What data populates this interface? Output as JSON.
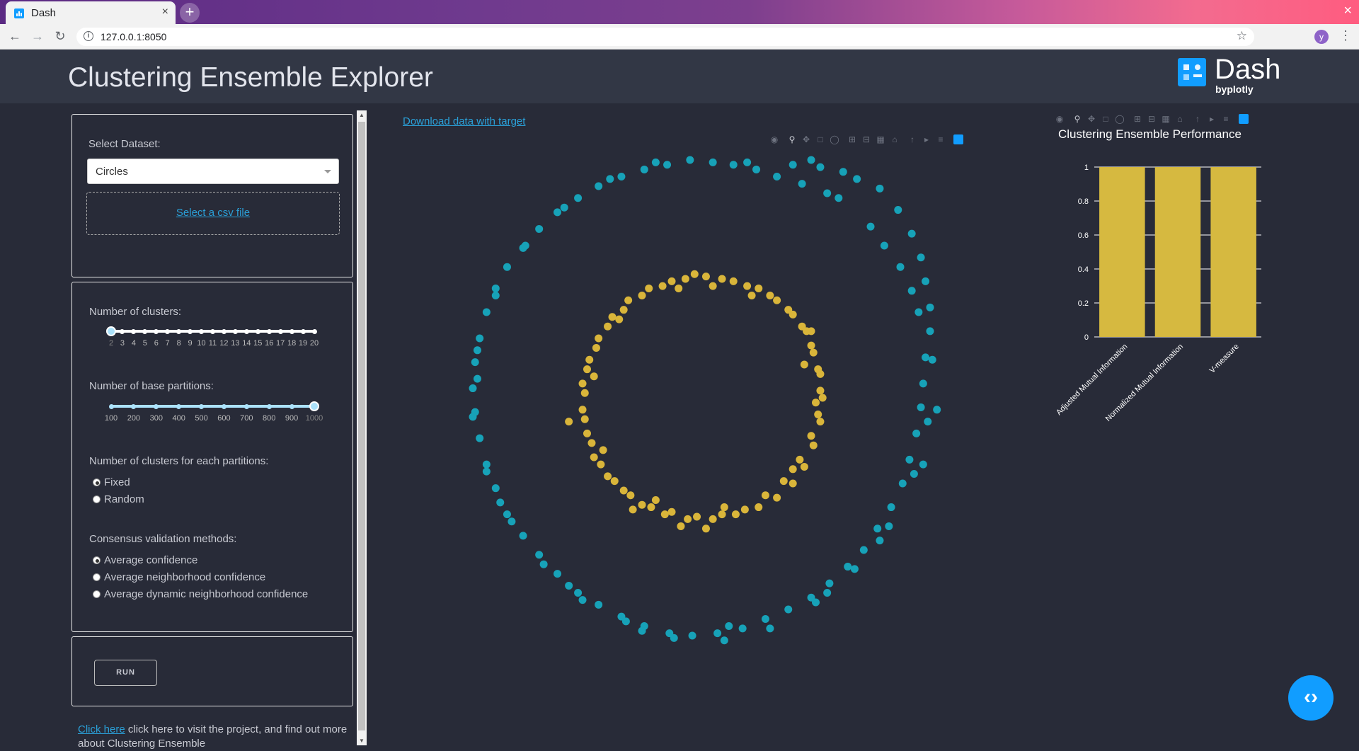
{
  "browser": {
    "tab_title": "Dash",
    "tab_close": "×",
    "new_tab": "+",
    "window_close": "×",
    "url": "127.0.0.1:8050",
    "profile_initial": "y",
    "icons": [
      "back-arrow-icon",
      "forward-arrow-icon",
      "reload-icon",
      "info-icon",
      "star-icon",
      "menu-dots-icon"
    ]
  },
  "header": {
    "title": "Clustering Ensemble Explorer",
    "logo_word": "Dash",
    "logo_by": "byplotly"
  },
  "dataset": {
    "label": "Select Dataset:",
    "selected": "Circles",
    "upload_link": "Select a csv file"
  },
  "clusters_slider": {
    "label": "Number of clusters:",
    "marks": [
      "2",
      "3",
      "4",
      "5",
      "6",
      "7",
      "8",
      "9",
      "10",
      "11",
      "12",
      "13",
      "14",
      "15",
      "16",
      "17",
      "18",
      "19",
      "20"
    ],
    "value": "2"
  },
  "partitions_slider": {
    "label": "Number of base partitions:",
    "marks": [
      "100",
      "200",
      "300",
      "400",
      "500",
      "600",
      "700",
      "800",
      "900",
      "1000"
    ],
    "value": "1000"
  },
  "cluster_mode": {
    "label": "Number of clusters for each partitions:",
    "options": [
      "Fixed",
      "Random"
    ],
    "selected": "Fixed"
  },
  "validation": {
    "label": "Consensus validation methods:",
    "options": [
      "Average confidence",
      "Average neighborhood confidence",
      "Average dynamic neighborhood confidence"
    ],
    "selected": "Average confidence"
  },
  "run_button": "RUN",
  "footer": {
    "link": "Click here",
    "text": " click here to visit the project, and find out more about Clustering Ensemble"
  },
  "download_link": "Download data with target",
  "modebar_icons": [
    "camera-icon",
    "zoom-icon",
    "pan-icon",
    "box-select-icon",
    "lasso-icon",
    "zoom-in-icon",
    "zoom-out-icon",
    "autoscale-icon",
    "reset-axes-icon",
    "spike-lines-icon",
    "hover-closest-icon",
    "hover-compare-icon",
    "plotly-logo-icon"
  ],
  "colors": {
    "background": "#282b38",
    "header": "#323745",
    "cluster_outer": "#17a2b8",
    "cluster_inner": "#d9b53a",
    "accent": "#119dff",
    "bar": "#d6b940"
  },
  "chart_data": [
    {
      "type": "scatter",
      "title": "",
      "xlabel": "",
      "ylabel": "",
      "grid": false,
      "series": [
        {
          "color": "#17a2b8",
          "points": [
            [
              0.4,
              0.98
            ],
            [
              0.48,
              1.0
            ],
            [
              0.52,
              0.97
            ],
            [
              0.62,
              0.95
            ],
            [
              0.68,
              0.92
            ],
            [
              0.78,
              0.88
            ],
            [
              0.86,
              0.79
            ],
            [
              0.92,
              0.69
            ],
            [
              0.96,
              0.59
            ],
            [
              0.98,
              0.49
            ],
            [
              1.0,
              0.38
            ],
            [
              1.0,
              0.28
            ],
            [
              0.98,
              0.17
            ],
            [
              0.97,
              0.06
            ],
            [
              0.96,
              -0.04
            ],
            [
              0.94,
              -0.15
            ],
            [
              0.91,
              -0.26
            ],
            [
              0.88,
              -0.36
            ],
            [
              0.83,
              -0.46
            ],
            [
              0.77,
              -0.55
            ],
            [
              0.71,
              -0.64
            ],
            [
              0.64,
              -0.71
            ],
            [
              0.56,
              -0.78
            ],
            [
              0.48,
              -0.84
            ],
            [
              0.38,
              -0.89
            ],
            [
              0.28,
              -0.93
            ],
            [
              0.18,
              -0.97
            ],
            [
              0.07,
              -0.99
            ],
            [
              -0.04,
              -1.0
            ],
            [
              -0.14,
              -0.99
            ],
            [
              -0.25,
              -0.96
            ],
            [
              -0.35,
              -0.92
            ],
            [
              -0.45,
              -0.87
            ],
            [
              -0.54,
              -0.82
            ],
            [
              -0.63,
              -0.74
            ],
            [
              -0.71,
              -0.66
            ],
            [
              -0.78,
              -0.58
            ],
            [
              -0.85,
              -0.49
            ],
            [
              -0.9,
              -0.38
            ],
            [
              -0.94,
              -0.28
            ],
            [
              -0.97,
              -0.17
            ],
            [
              -0.99,
              -0.06
            ],
            [
              -1.0,
              0.04
            ],
            [
              -0.99,
              0.15
            ],
            [
              -0.97,
              0.25
            ],
            [
              -0.94,
              0.36
            ],
            [
              -0.9,
              0.46
            ],
            [
              -0.85,
              0.55
            ],
            [
              -0.78,
              0.63
            ],
            [
              -0.71,
              0.71
            ],
            [
              -0.63,
              0.78
            ],
            [
              -0.54,
              0.84
            ],
            [
              -0.45,
              0.89
            ],
            [
              -0.35,
              0.93
            ],
            [
              -0.25,
              0.96
            ],
            [
              -0.15,
              0.98
            ],
            [
              -0.05,
              1.0
            ],
            [
              0.05,
              0.99
            ],
            [
              0.14,
              0.98
            ],
            [
              0.24,
              0.96
            ],
            [
              0.33,
              0.93
            ],
            [
              0.44,
              0.9
            ],
            [
              0.6,
              0.84
            ],
            [
              0.74,
              0.72
            ],
            [
              0.87,
              0.55
            ],
            [
              0.95,
              0.36
            ],
            [
              1.01,
              0.16
            ],
            [
              0.99,
              -0.1
            ],
            [
              0.93,
              -0.32
            ],
            [
              0.82,
              -0.54
            ],
            [
              0.67,
              -0.72
            ],
            [
              0.5,
              -0.86
            ],
            [
              0.3,
              -0.97
            ],
            [
              0.1,
              -1.02
            ],
            [
              -0.12,
              -1.01
            ],
            [
              -0.33,
              -0.94
            ],
            [
              -0.52,
              -0.85
            ],
            [
              -0.69,
              -0.7
            ],
            [
              -0.83,
              -0.52
            ],
            [
              -0.94,
              -0.31
            ],
            [
              -1.0,
              -0.08
            ],
            [
              -0.98,
              0.2
            ],
            [
              -0.9,
              0.43
            ],
            [
              -0.77,
              0.64
            ],
            [
              -0.6,
              0.8
            ],
            [
              -0.4,
              0.92
            ],
            [
              -0.2,
              0.99
            ],
            [
              0.2,
              0.99
            ],
            [
              0.55,
              0.86
            ],
            [
              0.8,
              0.64
            ],
            [
              0.92,
              0.45
            ],
            [
              1.03,
              -0.05
            ],
            [
              0.97,
              -0.28
            ],
            [
              0.78,
              -0.6
            ],
            [
              0.55,
              -0.82
            ],
            [
              0.12,
              -0.96
            ],
            [
              -0.26,
              -0.98
            ],
            [
              -0.58,
              -0.79
            ],
            [
              -0.88,
              -0.44
            ],
            [
              -0.98,
              0.08
            ]
          ]
        },
        {
          "color": "#d9b53a",
          "points": [
            [
              0.02,
              0.51
            ],
            [
              0.14,
              0.49
            ],
            [
              0.25,
              0.46
            ],
            [
              0.33,
              0.41
            ],
            [
              0.4,
              0.35
            ],
            [
              0.46,
              0.28
            ],
            [
              0.49,
              0.19
            ],
            [
              0.52,
              0.1
            ],
            [
              0.53,
              0.0
            ],
            [
              0.52,
              -0.1
            ],
            [
              0.49,
              -0.2
            ],
            [
              0.45,
              -0.29
            ],
            [
              0.4,
              -0.36
            ],
            [
              0.33,
              -0.42
            ],
            [
              0.25,
              -0.46
            ],
            [
              0.15,
              -0.49
            ],
            [
              0.05,
              -0.51
            ],
            [
              -0.06,
              -0.51
            ],
            [
              -0.16,
              -0.49
            ],
            [
              -0.26,
              -0.45
            ],
            [
              -0.34,
              -0.39
            ],
            [
              -0.41,
              -0.33
            ],
            [
              -0.47,
              -0.25
            ],
            [
              -0.5,
              -0.15
            ],
            [
              -0.52,
              -0.05
            ],
            [
              -0.52,
              0.06
            ],
            [
              -0.49,
              0.16
            ],
            [
              -0.45,
              0.25
            ],
            [
              -0.39,
              0.34
            ],
            [
              -0.32,
              0.41
            ],
            [
              -0.23,
              0.46
            ],
            [
              -0.13,
              0.49
            ],
            [
              -0.03,
              0.52
            ],
            [
              0.09,
              0.5
            ],
            [
              0.2,
              0.47
            ],
            [
              0.3,
              0.43
            ],
            [
              0.38,
              0.37
            ],
            [
              0.44,
              0.3
            ],
            [
              0.48,
              0.22
            ],
            [
              0.51,
              0.12
            ],
            [
              0.52,
              0.03
            ],
            [
              0.51,
              -0.07
            ],
            [
              0.48,
              -0.16
            ],
            [
              0.43,
              -0.26
            ],
            [
              0.36,
              -0.35
            ],
            [
              0.28,
              -0.41
            ],
            [
              0.19,
              -0.47
            ],
            [
              0.09,
              -0.49
            ],
            [
              -0.02,
              -0.5
            ],
            [
              -0.13,
              -0.48
            ],
            [
              -0.22,
              -0.46
            ],
            [
              -0.31,
              -0.41
            ],
            [
              -0.38,
              -0.35
            ],
            [
              -0.44,
              -0.28
            ],
            [
              -0.48,
              -0.19
            ],
            [
              -0.51,
              -0.09
            ],
            [
              -0.51,
              0.02
            ],
            [
              -0.5,
              0.12
            ],
            [
              -0.46,
              0.21
            ],
            [
              -0.41,
              0.3
            ],
            [
              -0.34,
              0.37
            ],
            [
              -0.26,
              0.43
            ],
            [
              -0.17,
              0.47
            ],
            [
              -0.07,
              0.5
            ],
            [
              0.05,
              0.47
            ],
            [
              0.22,
              0.43
            ],
            [
              0.45,
              0.14
            ],
            [
              0.5,
              -0.02
            ],
            [
              0.4,
              -0.3
            ],
            [
              0.1,
              -0.46
            ],
            [
              -0.2,
              -0.43
            ],
            [
              -0.43,
              -0.22
            ],
            [
              -0.47,
              0.09
            ],
            [
              -0.36,
              0.33
            ],
            [
              -0.1,
              0.46
            ],
            [
              -0.09,
              -0.54
            ],
            [
              0.48,
              0.28
            ],
            [
              -0.58,
              -0.1
            ],
            [
              0.02,
              -0.55
            ],
            [
              -0.3,
              -0.47
            ]
          ]
        }
      ]
    },
    {
      "type": "bar",
      "title": "Clustering Ensemble Performance",
      "categories": [
        "Adjusted Mutual Information",
        "Normalized Mutual Information",
        "V-measure"
      ],
      "values": [
        1,
        1,
        1
      ],
      "ylim": [
        0,
        1
      ],
      "yticks": [
        "0",
        "0.2",
        "0.4",
        "0.6",
        "0.8",
        "1"
      ],
      "grid": true
    }
  ]
}
